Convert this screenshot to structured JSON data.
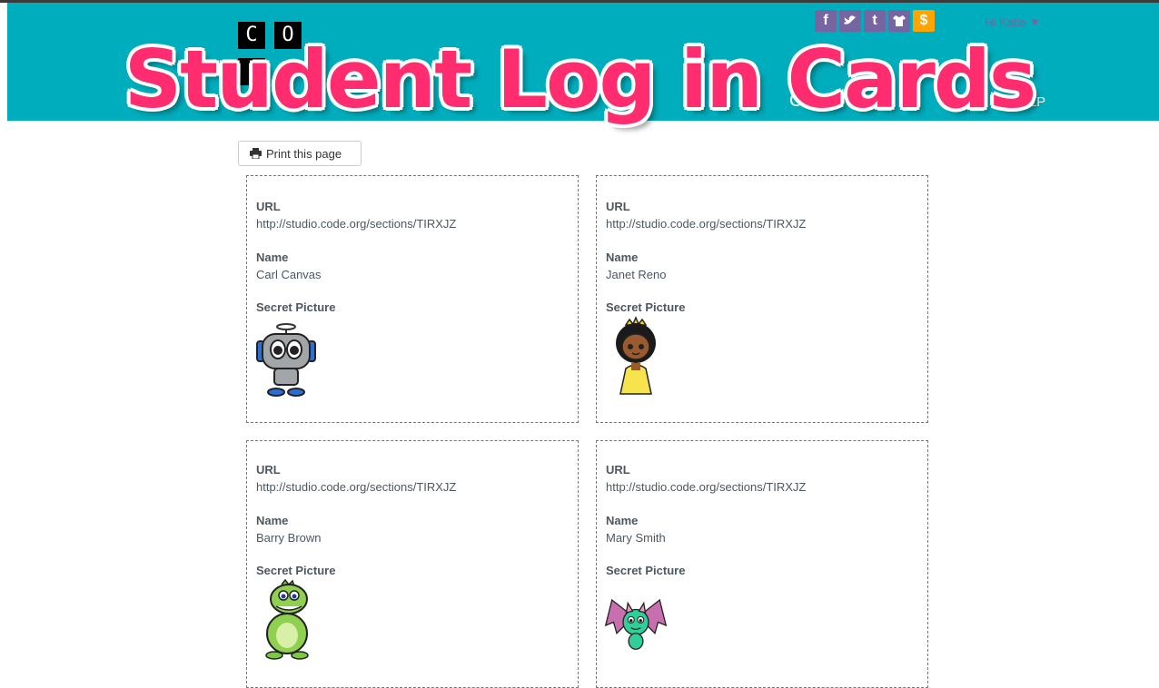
{
  "header": {
    "logo_letters": [
      "C",
      "O"
    ],
    "greeting": "Hi Katie ▼",
    "nav_help": "HELP",
    "social_icons": [
      {
        "icon": "facebook-icon",
        "glyph": "f"
      },
      {
        "icon": "twitter-icon",
        "glyph": "❧"
      },
      {
        "icon": "tumblr-icon",
        "glyph": "t"
      },
      {
        "icon": "shirt-icon",
        "glyph": "⬟"
      },
      {
        "icon": "donate-dollar-icon",
        "glyph": "$"
      }
    ],
    "colors": {
      "header_bg": "#00adbc",
      "social_bg": "#7665a0",
      "donate_bg": "#ffa400"
    }
  },
  "overlay": {
    "title": "Student Log in Cards",
    "color": "#ff2d6f"
  },
  "toolbar": {
    "print_label": "Print this page"
  },
  "cards": [
    {
      "url_label": "URL",
      "url": "http://studio.code.org/sections/TIRXJZ",
      "name_label": "Name",
      "name": "Carl Canvas",
      "picture_label": "Secret Picture",
      "picture": "robot"
    },
    {
      "url_label": "URL",
      "url": "http://studio.code.org/sections/TIRXJZ",
      "name_label": "Name",
      "name": "Janet Reno",
      "picture_label": "Secret Picture",
      "picture": "princess"
    },
    {
      "url_label": "URL",
      "url": "http://studio.code.org/sections/TIRXJZ",
      "name_label": "Name",
      "name": "Barry Brown",
      "picture_label": "Secret Picture",
      "picture": "dinosaur"
    },
    {
      "url_label": "URL",
      "url": "http://studio.code.org/sections/TIRXJZ",
      "name_label": "Name",
      "name": "Mary Smith",
      "picture_label": "Secret Picture",
      "picture": "bat"
    }
  ]
}
